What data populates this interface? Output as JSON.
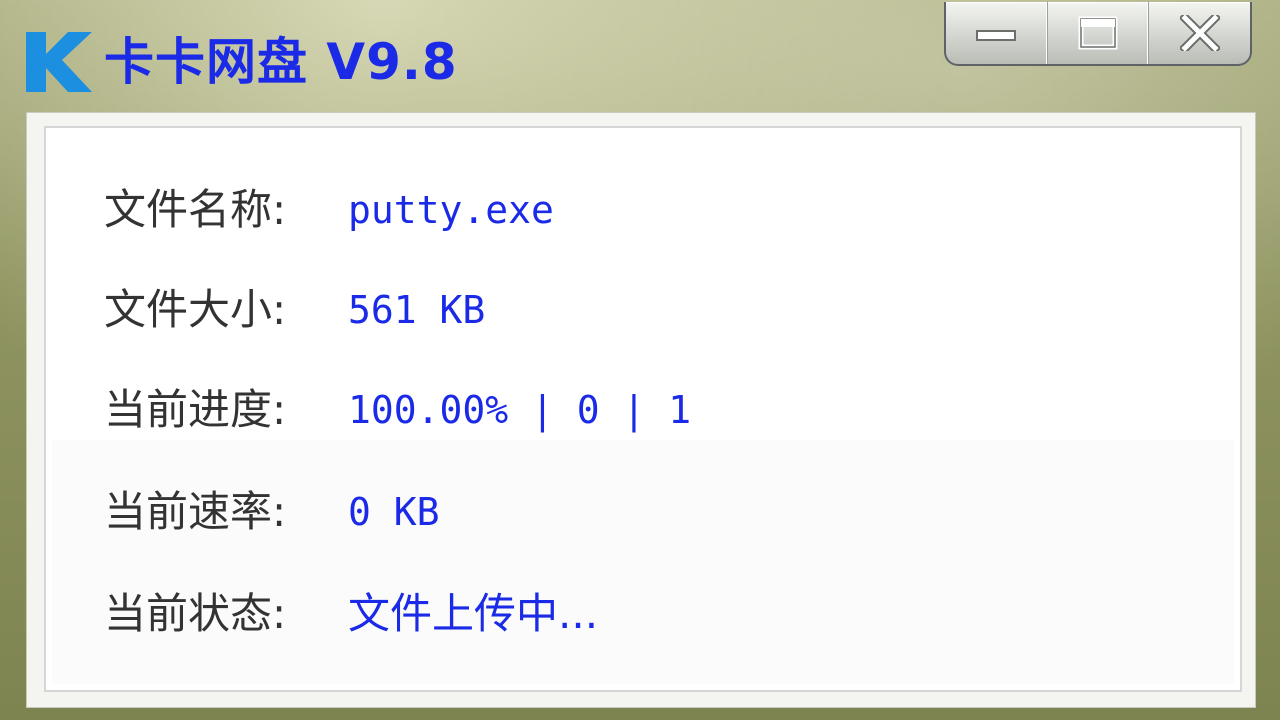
{
  "window": {
    "title": "卡卡网盘 V9.8",
    "logo_icon": "k-logo-icon",
    "accent_color": "#1a2ae6",
    "controls": {
      "minimize_icon": "minimize-icon",
      "maximize_icon": "maximize-icon",
      "close_icon": "close-icon"
    }
  },
  "info": {
    "file_name": {
      "label": "文件名称:",
      "value": "putty.exe"
    },
    "file_size": {
      "label": "文件大小:",
      "value": "561 KB"
    },
    "progress": {
      "label": "当前进度:",
      "value": "100.00% | 0 | 1"
    },
    "speed": {
      "label": "当前速率:",
      "value": "0 KB"
    },
    "status": {
      "label": "当前状态:",
      "value": "文件上传中..."
    }
  }
}
